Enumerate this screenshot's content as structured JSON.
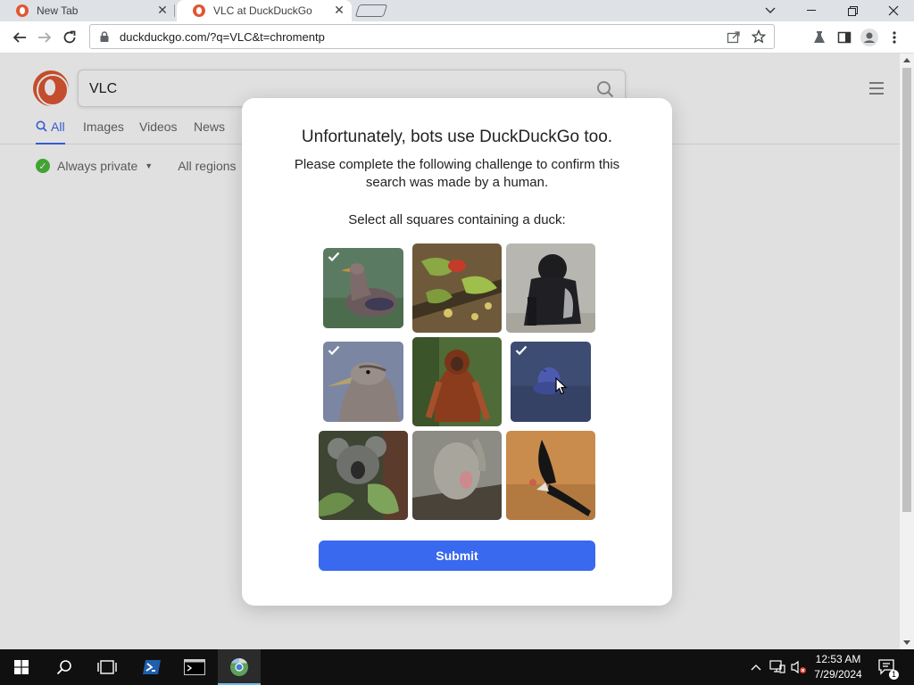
{
  "browser": {
    "tabs": [
      {
        "label": "New Tab",
        "active": false
      },
      {
        "label": "VLC at DuckDuckGo",
        "active": true
      }
    ],
    "url": "duckduckgo.com/?q=VLC&t=chromentp"
  },
  "page": {
    "search_query": "VLC",
    "tabs": [
      "All",
      "Images",
      "Videos",
      "News"
    ],
    "filters": {
      "privacy": "Always private",
      "region": "All regions"
    }
  },
  "challenge": {
    "title": "Unfortunately, bots use DuckDuckGo too.",
    "subtitle": "Please complete the following challenge to confirm this search was made by a human.",
    "prompt": "Select all squares containing a duck:",
    "tiles": [
      {
        "subject": "duck",
        "selected": true
      },
      {
        "subject": "bird",
        "selected": false
      },
      {
        "subject": "gorilla",
        "selected": false
      },
      {
        "subject": "duck",
        "selected": true
      },
      {
        "subject": "orangutan",
        "selected": false
      },
      {
        "subject": "duck",
        "selected": true
      },
      {
        "subject": "koala",
        "selected": false
      },
      {
        "subject": "kangaroo",
        "selected": false
      },
      {
        "subject": "condor",
        "selected": false
      }
    ],
    "submit_label": "Submit"
  },
  "taskbar": {
    "time": "12:53 AM",
    "date": "7/29/2024",
    "notification_count": "1"
  },
  "colors": {
    "accent": "#3969ef",
    "ddg_orange": "#de5833",
    "private_green": "#4cba3c"
  }
}
